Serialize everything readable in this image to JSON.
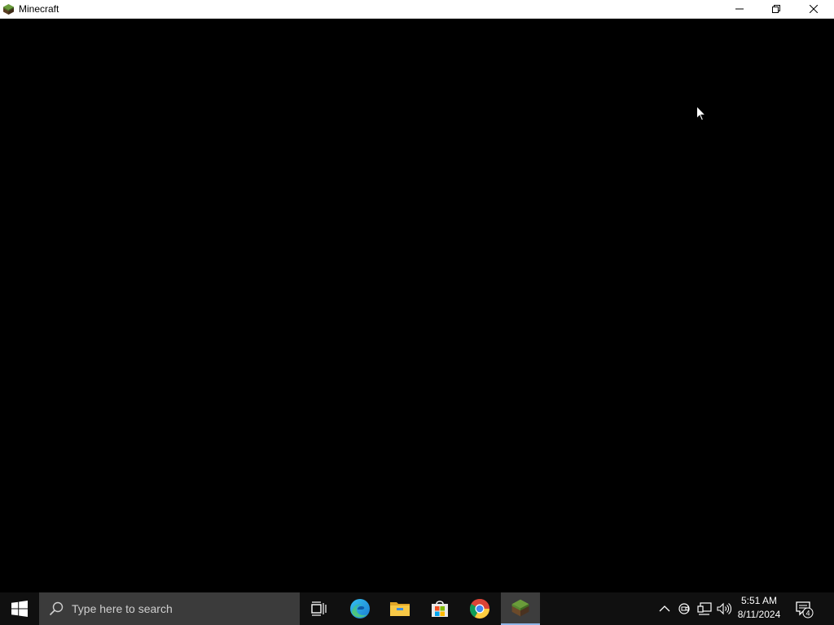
{
  "window": {
    "title": "Minecraft",
    "app_icon": "minecraft-grass-block-icon",
    "controls": [
      "minimize-icon",
      "restore-icon",
      "close-icon"
    ]
  },
  "content": {
    "background_color": "#000000"
  },
  "taskbar": {
    "start_icon": "windows-logo-icon",
    "search_placeholder": "Type here to search",
    "pinned_apps": [
      {
        "name": "Task View",
        "icon": "task-view-icon"
      },
      {
        "name": "Microsoft Edge",
        "icon": "edge-icon"
      },
      {
        "name": "File Explorer",
        "icon": "folder-icon"
      },
      {
        "name": "Microsoft Store",
        "icon": "store-icon"
      },
      {
        "name": "Google Chrome",
        "icon": "chrome-icon"
      },
      {
        "name": "Minecraft",
        "icon": "minecraft-grass-block-icon",
        "active": true
      }
    ],
    "tray": {
      "icons": [
        "chevron-up-icon",
        "meet-now-icon",
        "network-icon",
        "volume-icon"
      ],
      "time": "5:51 AM",
      "date": "8/11/2024",
      "notification_count": "4"
    }
  },
  "colors": {
    "taskbar_bg": "#101010",
    "search_bg": "#3b3b3b",
    "active_indicator": "#8fb5e6"
  }
}
